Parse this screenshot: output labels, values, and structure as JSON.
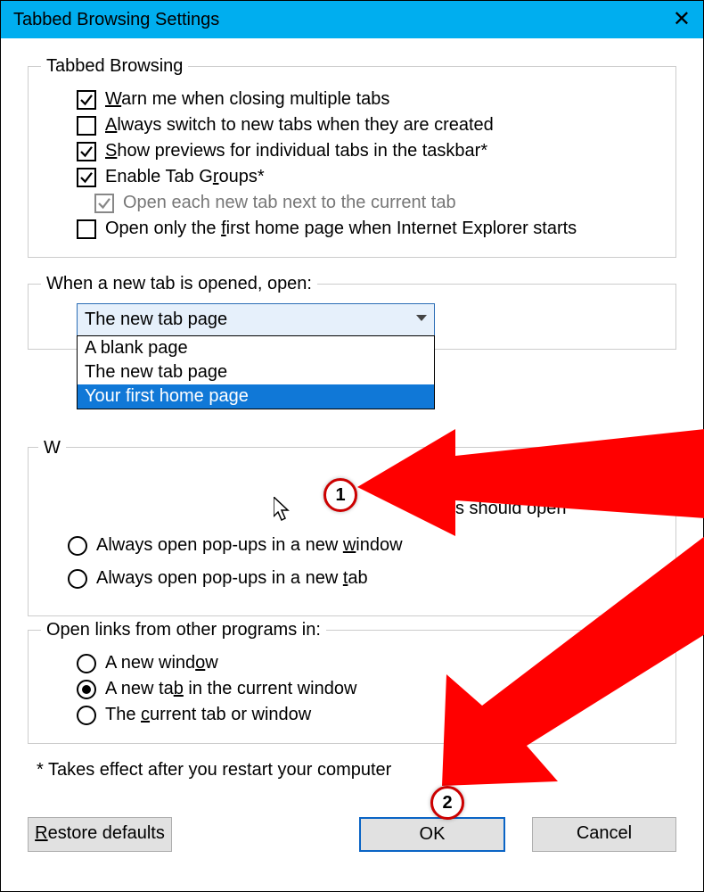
{
  "window": {
    "title": "Tabbed Browsing Settings"
  },
  "groupTabbed": {
    "legend": "Tabbed Browsing",
    "warn_label_pre": "W",
    "warn_label_post": "arn me when closing multiple tabs",
    "always_switch_pre": "A",
    "always_switch_post": "lways switch to new tabs when they are created",
    "show_previews_pre": "S",
    "show_previews_post": "how previews for individual tabs in the taskbar*",
    "enable_groups_pre": "Enable Tab G",
    "enable_groups_post": "roups*",
    "open_next": "Open each new tab next to the current tab",
    "open_only_first_pre": "Open only the f",
    "open_only_first_post": "irst home page when Internet Explorer starts"
  },
  "groupNewTab": {
    "legend": "When a new tab is opened, open:",
    "selected": "The new tab page",
    "options": {
      "0": "A blank page",
      "1": "The new tab page",
      "2": "Your first home page"
    }
  },
  "groupPopups": {
    "legend_partial": "W",
    "hint_right": "s should open",
    "opt_window_pre": "Always open pop-ups in a new w",
    "opt_window_post": "indow",
    "opt_tab_pre": "Always open pop-ups in a new t",
    "opt_tab_post": "ab"
  },
  "groupLinks": {
    "legend": "Open links from other programs in:",
    "opt_window_pre": "A new wind",
    "opt_window_post": "ow",
    "opt_tab_pre": "A new ta",
    "opt_tab_post": "b in the current window",
    "opt_current_pre": "The c",
    "opt_current_post": "urrent tab or window"
  },
  "footnote": "* Takes effect after you restart your computer",
  "buttons": {
    "restore_pre": "R",
    "restore_post": "estore defaults",
    "ok": "OK",
    "cancel": "Cancel"
  },
  "annot": {
    "badge1": "1",
    "badge2": "2"
  }
}
